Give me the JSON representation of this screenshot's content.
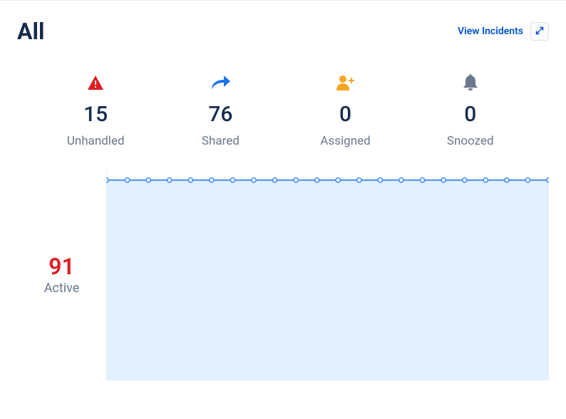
{
  "header": {
    "title": "All",
    "view_link": "View Incidents"
  },
  "stats": [
    {
      "icon": "alert-triangle-icon",
      "value": "15",
      "label": "Unhandled"
    },
    {
      "icon": "share-arrow-icon",
      "value": "76",
      "label": "Shared"
    },
    {
      "icon": "user-plus-icon",
      "value": "0",
      "label": "Assigned"
    },
    {
      "icon": "bell-icon",
      "value": "0",
      "label": "Snoozed"
    }
  ],
  "active": {
    "value": "91",
    "label": "Active"
  },
  "colors": {
    "red": "#de1c22",
    "blue": "#1a73e8",
    "orange": "#f5a623",
    "gray": "#6b778c",
    "chart_line": "#4a90e2",
    "chart_fill": "#e3f0ff"
  },
  "chart_data": {
    "type": "line",
    "title": "",
    "xlabel": "",
    "ylabel": "",
    "ylim": [
      0,
      100
    ],
    "x": [
      0,
      1,
      2,
      3,
      4,
      5,
      6,
      7,
      8,
      9,
      10,
      11,
      12,
      13,
      14,
      15,
      16,
      17,
      18,
      19,
      20,
      21
    ],
    "values": [
      95,
      95,
      95,
      95,
      95,
      95,
      95,
      95,
      95,
      95,
      95,
      95,
      95,
      95,
      95,
      95,
      95,
      95,
      95,
      95,
      95,
      95
    ]
  }
}
